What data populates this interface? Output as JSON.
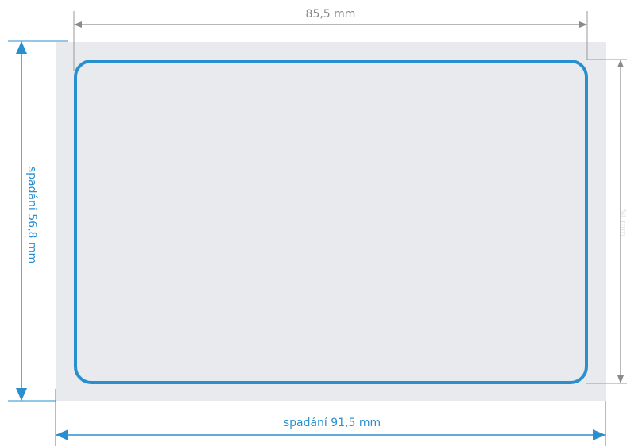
{
  "dimensions": {
    "trim_width": "85,5 mm",
    "bleed_height": "spadání 56,8 mm",
    "bleed_width": "spadání 91,5 mm",
    "trim_height": "54 mm"
  },
  "colors": {
    "bleed_fill": "#e9eaed",
    "trim_outline": "#2a8fcf",
    "bleed_arrow": "#2a8fcf",
    "trim_arrow": "#8a8a8a",
    "trim_guide": "#9a9a9a",
    "background": "#ffffff"
  }
}
